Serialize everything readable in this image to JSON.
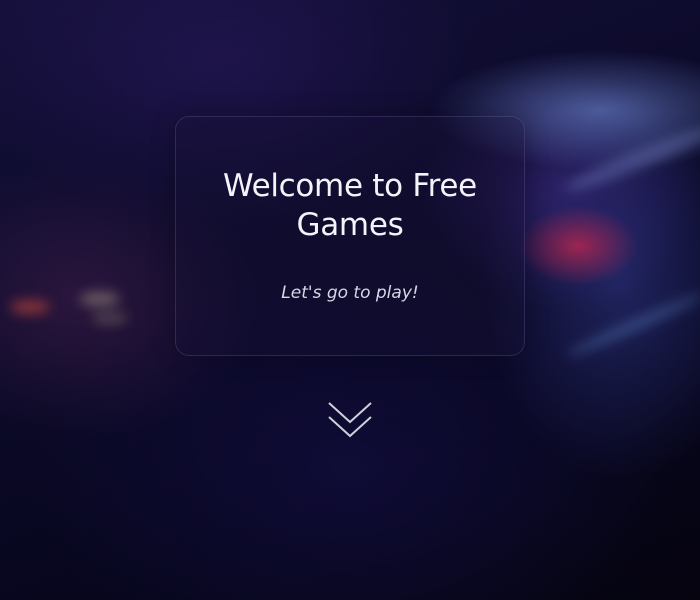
{
  "hero": {
    "title": "Welcome to Free Games",
    "subtitle": "Let's go to play!"
  },
  "scroll_down": {
    "icon": "double-chevron-down-icon"
  },
  "colors": {
    "background": "#0c0a2a",
    "text": "#f4f3fa",
    "chevron": "#d0d0dc"
  }
}
